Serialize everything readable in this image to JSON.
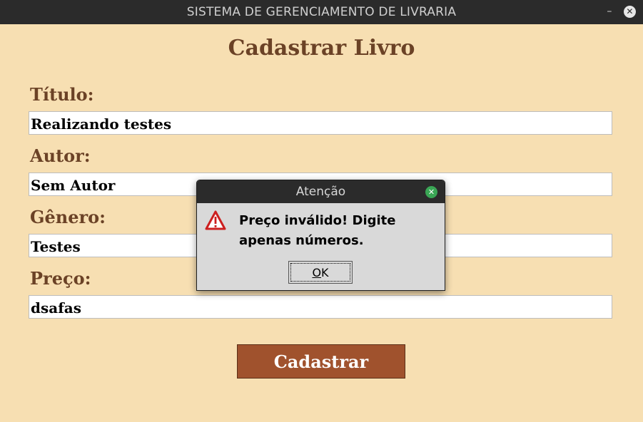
{
  "window": {
    "title": "SISTEMA DE GERENCIAMENTO DE LIVRARIA",
    "minimize_glyph": "–",
    "close_glyph": "✕"
  },
  "form": {
    "title": "Cadastrar Livro",
    "fields": [
      {
        "label": "Título:",
        "value": "Realizando testes"
      },
      {
        "label": "Autor:",
        "value": "Sem Autor"
      },
      {
        "label": "Gênero:",
        "value": "Testes"
      },
      {
        "label": "Preço:",
        "value": "dsafas"
      }
    ],
    "submit_label": "Cadastrar"
  },
  "dialog": {
    "title": "Atenção",
    "message": "Preço inválido! Digite apenas números.",
    "ok_mnemonic": "O",
    "ok_rest": "K",
    "icon": "warning-icon",
    "close_glyph": "✕"
  },
  "colors": {
    "background": "#f7dfb2",
    "label": "#6b4226",
    "button": "#a0522d",
    "titlebar": "#2b2b2b",
    "dialog_bg": "#d9d9d9",
    "dialog_close": "#3aa655",
    "warning_red": "#cc1f1f"
  }
}
